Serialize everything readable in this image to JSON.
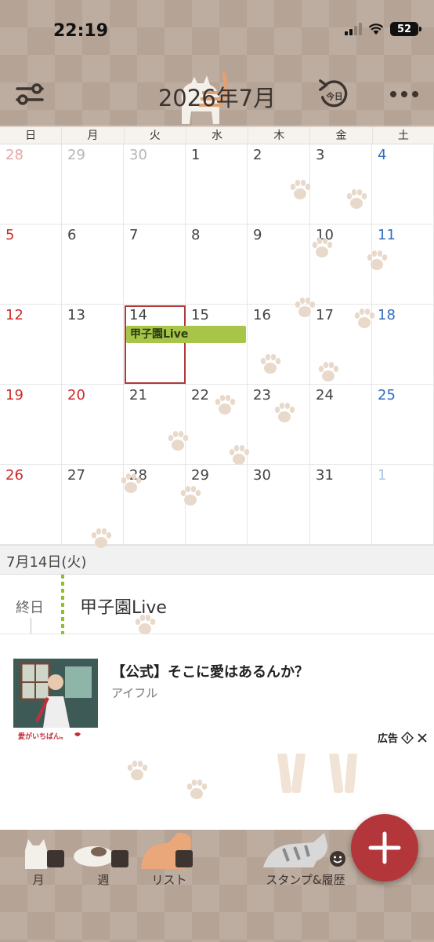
{
  "status": {
    "time": "22:19",
    "battery": "52"
  },
  "header": {
    "month_title": "2026年7月",
    "today_label": "今日"
  },
  "weekdays": [
    "日",
    "月",
    "火",
    "水",
    "木",
    "金",
    "土"
  ],
  "calendar": {
    "weeks": [
      [
        "28",
        "29",
        "30",
        "1",
        "2",
        "3",
        "4"
      ],
      [
        "5",
        "6",
        "7",
        "8",
        "9",
        "10",
        "11"
      ],
      [
        "12",
        "13",
        "14",
        "15",
        "16",
        "17",
        "18"
      ],
      [
        "19",
        "20",
        "21",
        "22",
        "23",
        "24",
        "25"
      ],
      [
        "26",
        "27",
        "28",
        "29",
        "30",
        "31",
        "1"
      ]
    ],
    "selected_date": "14",
    "holiday": "20"
  },
  "event_bar": {
    "title": "甲子園Live",
    "color": "#a8c54a"
  },
  "day_detail": {
    "date_label": "7月14日(火)",
    "allday_label": "終日",
    "event_title": "甲子園Live"
  },
  "ad": {
    "title": "【公式】そこに愛はあるんか？",
    "sponsor": "アイフル",
    "label": "広告",
    "thumb_caption": "愛がいちばん。"
  },
  "tabs": [
    {
      "label": "月",
      "icon": "calendar-month-icon"
    },
    {
      "label": "週",
      "icon": "calendar-week-icon"
    },
    {
      "label": "リスト",
      "icon": "list-icon"
    },
    {
      "label": "スタンプ&履歴",
      "icon": "smile-icon"
    }
  ],
  "colors": {
    "accent": "#b3363a",
    "chrome": "#b5a395",
    "sunday": "#cc2b2b",
    "saturday": "#2f6ebf"
  }
}
